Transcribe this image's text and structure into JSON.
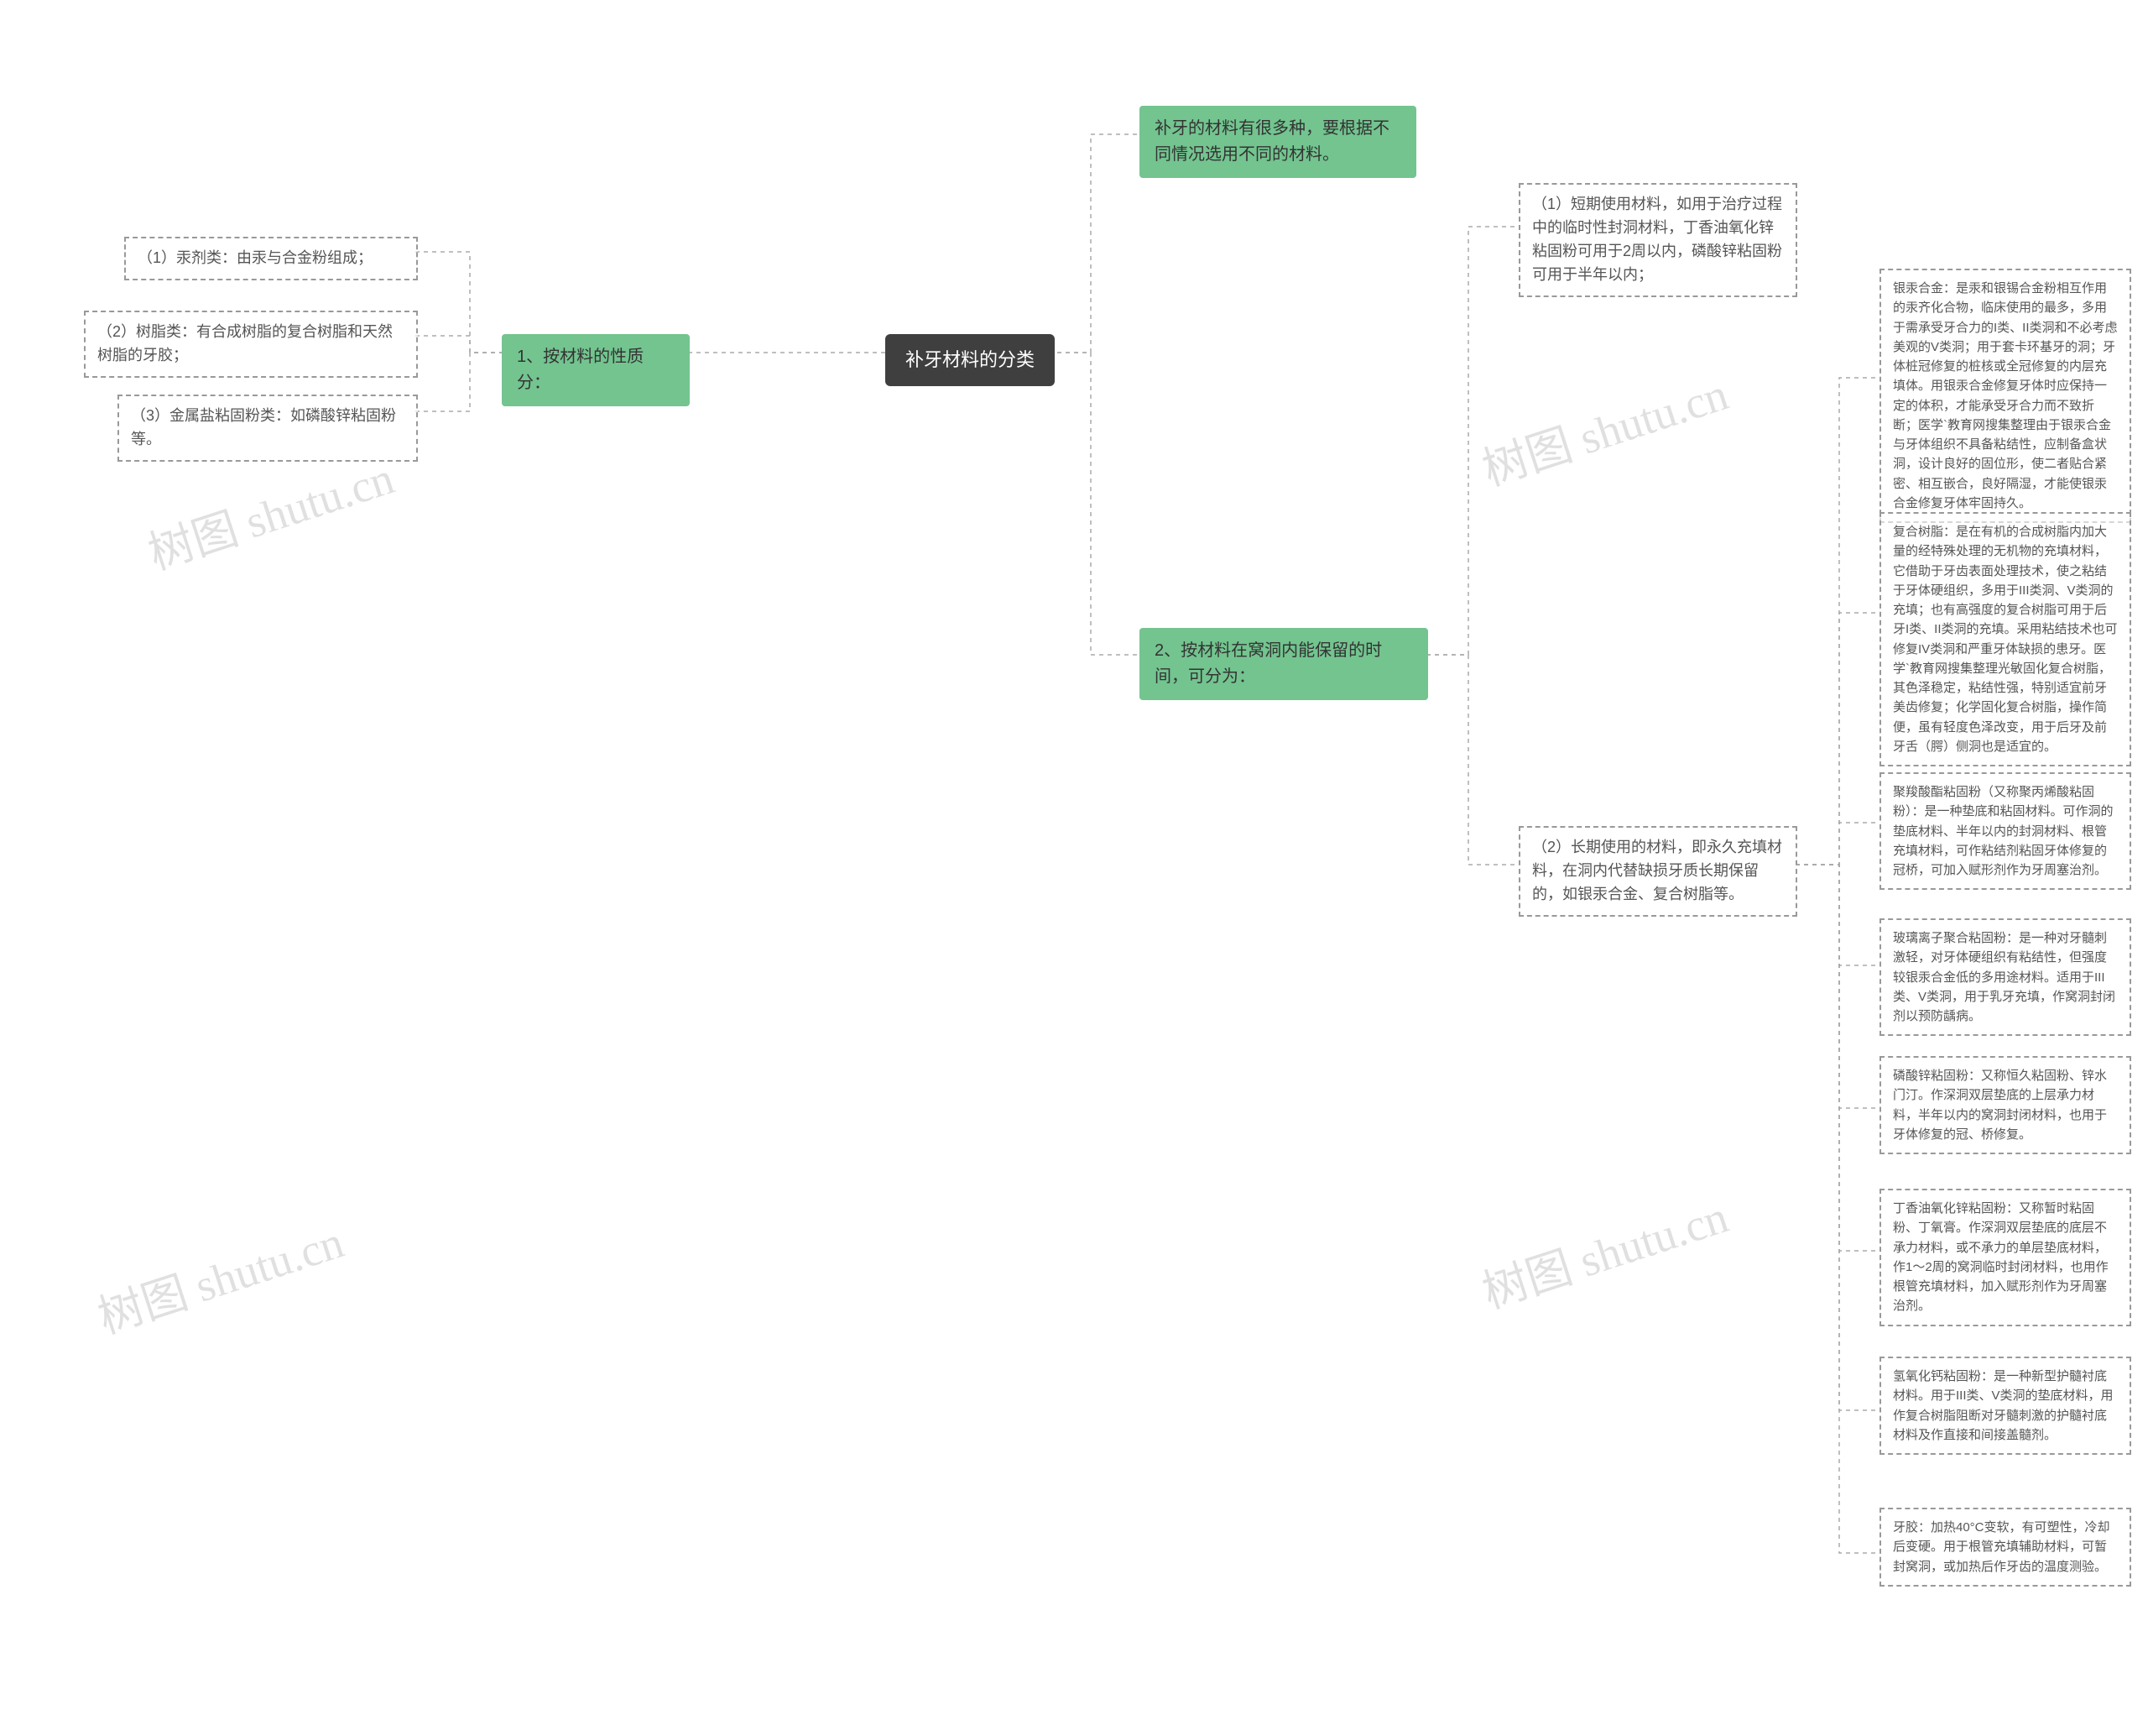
{
  "watermark": "树图 shutu.cn",
  "root": {
    "label": "补牙材料的分类"
  },
  "intro": {
    "text": "补牙的材料有很多种，要根据不同情况选用不同的材料。"
  },
  "left_branch": {
    "label": "1、按材料的性质分：",
    "items": [
      "（1）汞剂类：由汞与合金粉组成；",
      "（2）树脂类：有合成树脂的复合树脂和天然树脂的牙胶；",
      "（3）金属盐粘固粉类：如磷酸锌粘固粉等。"
    ]
  },
  "right_branch": {
    "label": "2、按材料在窝洞内能保留的时间，可分为：",
    "sub": [
      {
        "text": "（1）短期使用材料，如用于治疗过程中的临时性封洞材料，丁香油氧化锌粘固粉可用于2周以内，磷酸锌粘固粉可用于半年以内；"
      },
      {
        "text": "（2）长期使用的材料，即永久充填材料，在洞内代替缺损牙质长期保留的，如银汞合金、复合树脂等。",
        "details": [
          "银汞合金：是汞和银锡合金粉相互作用的汞齐化合物，临床使用的最多，多用于需承受牙合力的I类、II类洞和不必考虑美观的V类洞；用于套卡环基牙的洞；牙体桩冠修复的桩核或全冠修复的内层充填体。用银汞合金修复牙体时应保持一定的体积，才能承受牙合力而不致折断；医学`教育网搜集整理由于银汞合金与牙体组织不具备粘结性，应制备盒状洞，设计良好的固位形，使二者贴合紧密、相互嵌合，良好隔湿，才能使银汞合金修复牙体牢固持久。",
          "复合树脂：是在有机的合成树脂内加大量的经特殊处理的无机物的充填材料，它借助于牙齿表面处理技术，使之粘结于牙体硬组织，多用于III类洞、V类洞的充填；也有高强度的复合树脂可用于后牙I类、II类洞的充填。采用粘结技术也可修复IV类洞和严重牙体缺损的患牙。医学`教育网搜集整理光敏固化复合树脂，其色泽稳定，粘结性强，特别适宜前牙美齿修复；化学固化复合树脂，操作简便，虽有轻度色泽改变，用于后牙及前牙舌（腭）侧洞也是适宜的。",
          "聚羧酸酯粘固粉（又称聚丙烯酸粘固粉）：是一种垫底和粘固材料。可作洞的垫底材料、半年以内的封洞材料、根管充填材料，可作粘结剂粘固牙体修复的冠桥，可加入赋形剂作为牙周塞治剂。",
          "玻璃离子聚合粘固粉：是一种对牙髓刺激轻，对牙体硬组织有粘结性，但强度较银汞合金低的多用途材料。适用于III类、V类洞，用于乳牙充填，作窝洞封闭剂以预防龋病。",
          "磷酸锌粘固粉：又称恒久粘固粉、锌水门汀。作深洞双层垫底的上层承力材料，半年以内的窝洞封闭材料，也用于牙体修复的冠、桥修复。",
          "丁香油氧化锌粘固粉：又称暂时粘固粉、丁氧膏。作深洞双层垫底的底层不承力材料，或不承力的单层垫底材料，作1～2周的窝洞临时封闭材料，也用作根管充填材料，加入赋形剂作为牙周塞治剂。",
          "氢氧化钙粘固粉：是一种新型护髓衬底材料。用于III类、V类洞的垫底材料，用作复合树脂阻断对牙髓刺激的护髓衬底材料及作直接和间接盖髓剂。",
          "牙胶：加热40°C变软，有可塑性，冷却后变硬。用于根管充填辅助材料，可暂封窝洞，或加热后作牙齿的温度测验。"
        ]
      }
    ]
  }
}
